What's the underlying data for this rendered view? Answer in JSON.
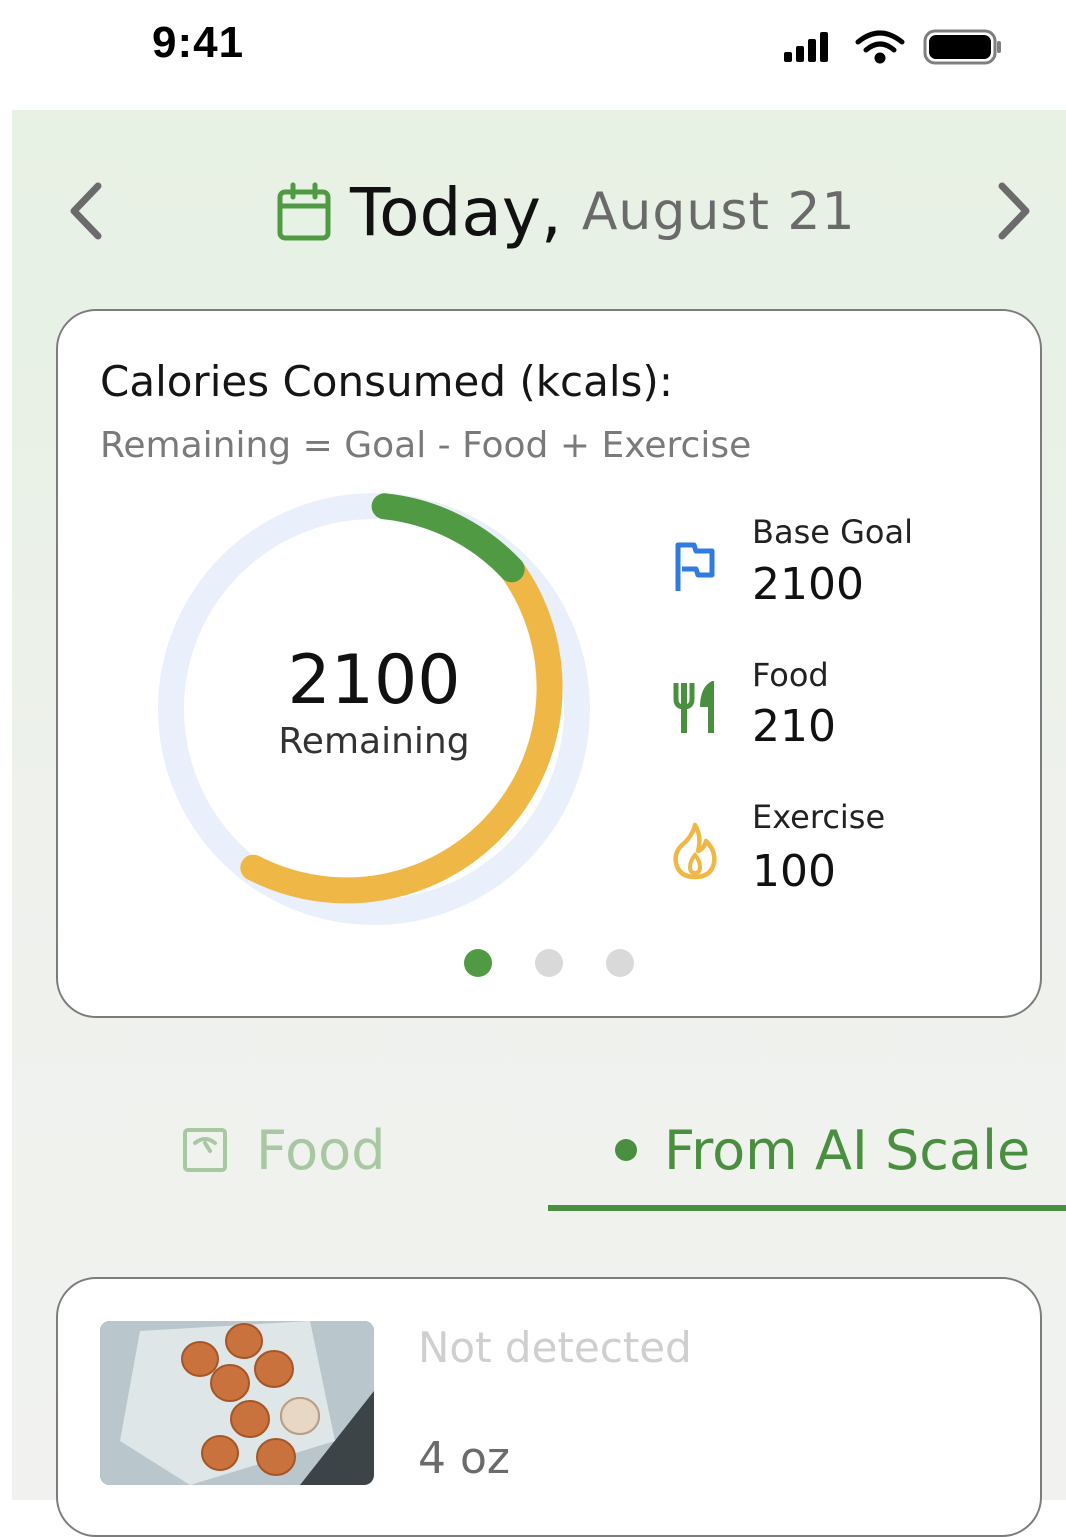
{
  "status_bar": {
    "time": "9:41"
  },
  "header": {
    "today": "Today,",
    "date": "August 21"
  },
  "calorie_card": {
    "title": "Calories Consumed (kcals):",
    "formula": "Remaining = Goal - Food + Exercise",
    "remaining_value": "2100",
    "remaining_label": "Remaining",
    "stats": [
      {
        "label": "Base Goal",
        "value": "2100",
        "icon": "flag-icon",
        "color": "#2f7be0"
      },
      {
        "label": "Food",
        "value": "210",
        "icon": "fork-knife-icon",
        "color": "#4a8f3f"
      },
      {
        "label": "Exercise",
        "value": "100",
        "icon": "flame-icon",
        "color": "#efb846"
      }
    ],
    "ring_colors": {
      "track": "#e9f0fb",
      "food": "#4f9a43",
      "exercise": "#efb846"
    },
    "page_indicator": {
      "count": 3,
      "active": 0
    }
  },
  "tabs": [
    {
      "label": "Food",
      "icon": "scale-icon",
      "active": false
    },
    {
      "label": "From AI Scale",
      "icon": "dot-icon",
      "active": true
    }
  ],
  "food_item": {
    "name": "Not detected",
    "quantity": "4 oz",
    "image": "eggs-in-carton"
  },
  "colors": {
    "accent": "#4a8f3f",
    "inactive_tab": "#a9c7a3"
  }
}
